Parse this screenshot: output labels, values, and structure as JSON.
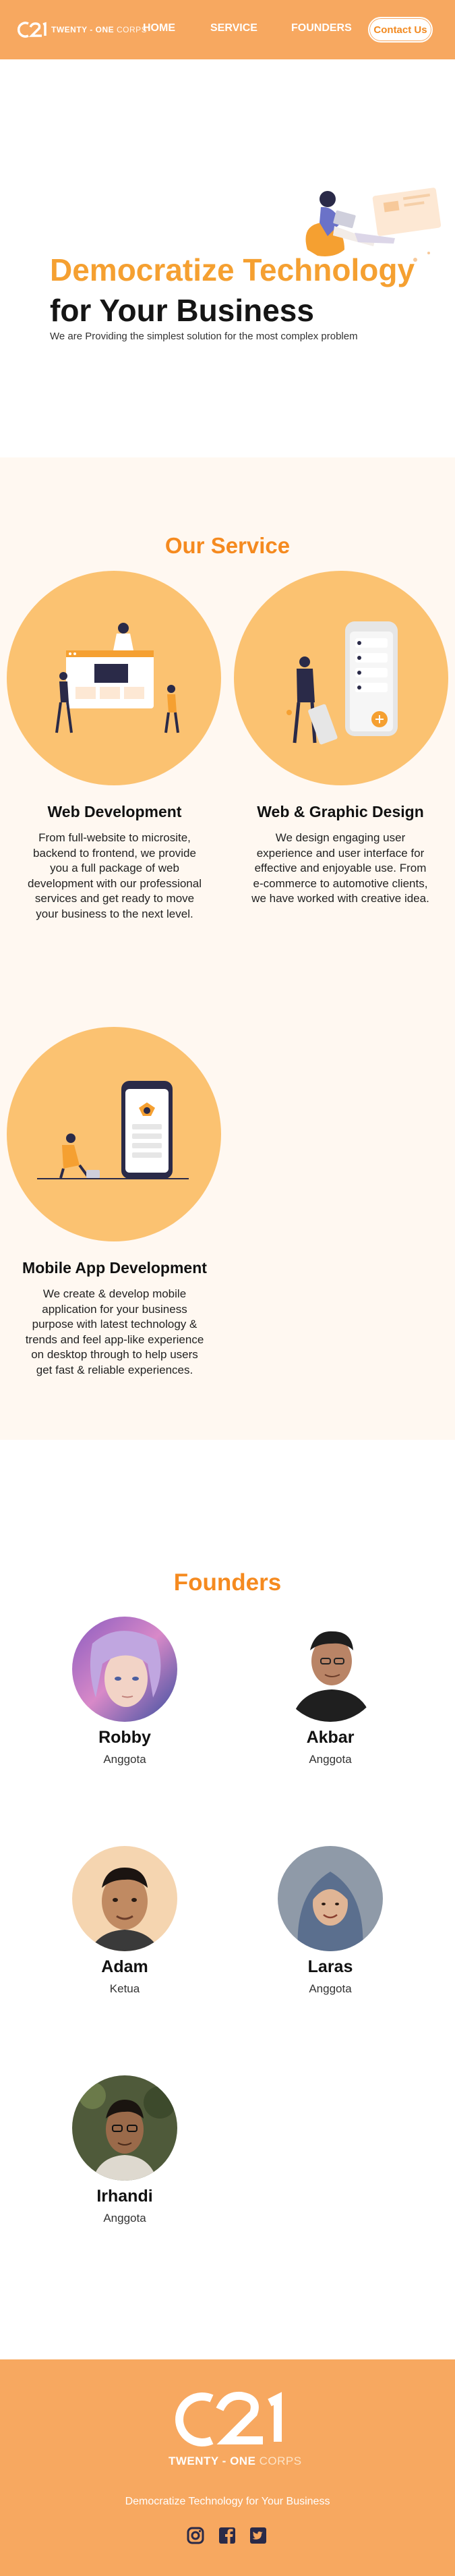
{
  "header": {
    "brand_primary": "TWENTY - ONE",
    "brand_secondary": "CORPS",
    "nav": {
      "home": "HOME",
      "service": "SERVICE",
      "founders": "FOUNDERS"
    },
    "contact_label": "Contact Us"
  },
  "hero": {
    "title_line1": "Democratize Technology",
    "title_line2": "for Your Business",
    "subtitle": "We are Providing the simplest solution for the most complex problem"
  },
  "service": {
    "heading": "Our Service",
    "items": [
      {
        "title": "Web Development",
        "desc": "From full-website to microsite, backend to frontend, we provide you a full package of web development with our professional services and get ready to move your business to the next level."
      },
      {
        "title": "Web & Graphic Design",
        "desc": "We design engaging user experience and user interface for effective and enjoyable use. From e-commerce to automotive clients, we have worked with creative idea."
      },
      {
        "title": "Mobile App Development",
        "desc": "We create & develop mobile application for your business purpose with latest technology & trends and feel app-like experience on desktop through to help users get fast & reliable experiences."
      }
    ]
  },
  "founders": {
    "heading": "Founders",
    "people": [
      {
        "name": "Robby",
        "role": "Anggota"
      },
      {
        "name": "Akbar",
        "role": "Anggota"
      },
      {
        "name": "Adam",
        "role": "Ketua"
      },
      {
        "name": "Laras",
        "role": "Anggota"
      },
      {
        "name": "Irhandi",
        "role": "Anggota"
      }
    ]
  },
  "footer": {
    "brand_primary": "TWENTY - ONE",
    "brand_secondary": "CORPS",
    "tagline": "Democratize Technology for Your Business",
    "social": [
      "instagram-icon",
      "facebook-icon",
      "twitter-icon"
    ]
  },
  "colors": {
    "accent": "#f58a1f",
    "header": "#f7a860",
    "circle": "#fbc271",
    "section_bg": "#fff8f1"
  }
}
